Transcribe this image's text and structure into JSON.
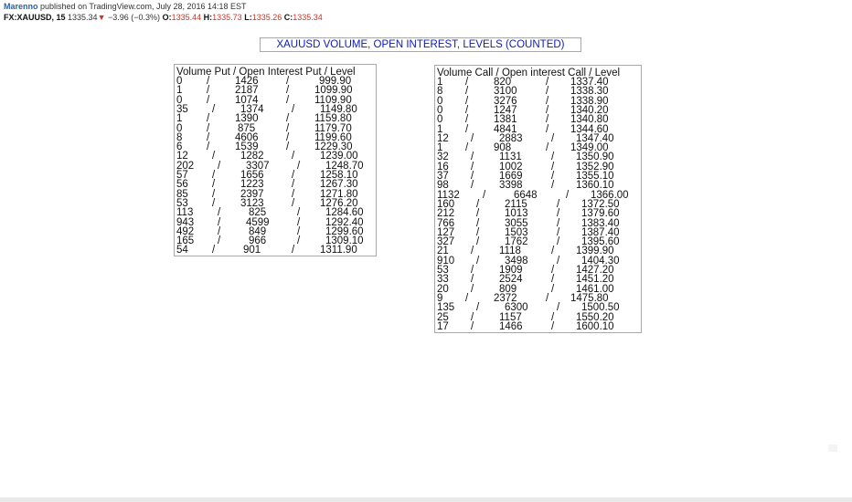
{
  "header": {
    "author": "Marenno",
    "published_text": "published on TradingView.com, July 28, 2016 14:18 EST",
    "symbol": "FX:XAUUSD, 15",
    "last_price": "1335.34",
    "change_arrow": "▼",
    "change": "−3.96 (−0.3%)",
    "open_label": "O:",
    "open_value": "1335.44",
    "high_label": "H:",
    "high_value": "1335.73",
    "low_label": "L:",
    "low_value": "1335.26",
    "close_label": "C:",
    "close_value": "1335.34",
    "colors": {
      "author": "#2962a6",
      "down": "#c0392b"
    }
  },
  "title": "XAUUSD VOLUME, OPEN INTEREST, LEVELS (COUNTED)",
  "puts": {
    "header": "Volume Put / Open Interest Put / Level",
    "rows": [
      [
        "0",
        "1426",
        "999.90"
      ],
      [
        "1",
        "2187",
        "1099.90"
      ],
      [
        "0",
        "1074",
        "1109.90"
      ],
      [
        "35",
        "1374",
        "1149.80"
      ],
      [
        "1",
        "1390",
        "1159.80"
      ],
      [
        "0",
        "875",
        "1179.70"
      ],
      [
        "8",
        "4606",
        "1199.60"
      ],
      [
        "6",
        "1539",
        "1229.30"
      ],
      [
        "12",
        "1282",
        "1239.00"
      ],
      [
        "202",
        "3307",
        "1248.70"
      ],
      [
        "57",
        "1656",
        "1258.10"
      ],
      [
        "56",
        "1223",
        "1267.30"
      ],
      [
        "85",
        "2397",
        "1271.80"
      ],
      [
        "53",
        "3123",
        "1276.20"
      ],
      [
        "113",
        "825",
        "1284.60"
      ],
      [
        "943",
        "4599",
        "1292.40"
      ],
      [
        "492",
        "849",
        "1299.60"
      ],
      [
        "165",
        "966",
        "1309.10"
      ],
      [
        "54",
        "901",
        "1311.90"
      ]
    ]
  },
  "calls": {
    "header": "Volume Call / Open interest Call / Level",
    "rows": [
      [
        "1",
        "820",
        "1337.40"
      ],
      [
        "8",
        "3100",
        "1338.30"
      ],
      [
        "0",
        "3276",
        "1338.90"
      ],
      [
        "0",
        "1247",
        "1340.20"
      ],
      [
        "0",
        "1381",
        "1340.80"
      ],
      [
        "1",
        "4841",
        "1344.60"
      ],
      [
        "12",
        "2883",
        "1347.40"
      ],
      [
        "1",
        "908",
        "1349.00"
      ],
      [
        "32",
        "1131",
        "1350.90"
      ],
      [
        "16",
        "1002",
        "1352.90"
      ],
      [
        "37",
        "1669",
        "1355.10"
      ],
      [
        "98",
        "3398",
        "1360.10"
      ],
      [
        "1132",
        "6648",
        "1366.00"
      ],
      [
        "160",
        "2115",
        "1372.50"
      ],
      [
        "212",
        "1013",
        "1379.60"
      ],
      [
        "766",
        "3055",
        "1383.40"
      ],
      [
        "127",
        "1503",
        "1387.40"
      ],
      [
        "327",
        "1762",
        "1395.60"
      ],
      [
        "21",
        "1118",
        "1399.90"
      ],
      [
        "910",
        "3498",
        "1404.30"
      ],
      [
        "53",
        "1909",
        "1427.20"
      ],
      [
        "33",
        "2524",
        "1451.20"
      ],
      [
        "20",
        "809",
        "1461.00"
      ],
      [
        "9",
        "2372",
        "1475.80"
      ],
      [
        "135",
        "6300",
        "1500.50"
      ],
      [
        "25",
        "1157",
        "1550.20"
      ],
      [
        "17",
        "1466",
        "1600.10"
      ]
    ]
  },
  "separator": "/"
}
